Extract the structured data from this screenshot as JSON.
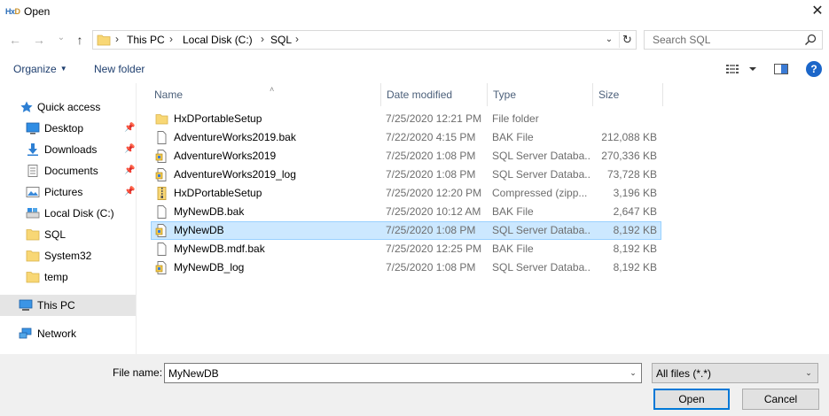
{
  "window": {
    "title": "Open",
    "app_icon_text_a": "Hx",
    "app_icon_text_b": "D",
    "close_glyph": "✕"
  },
  "nav": {
    "back_glyph": "←",
    "forward_glyph": "→",
    "recent_glyph": "⌄",
    "up_glyph": "↑"
  },
  "address": {
    "crumbs": [
      "This PC",
      "Local Disk (C:)",
      "SQL"
    ],
    "separator": "›",
    "dropdown_glyph": "⌄",
    "refresh_glyph": "↻"
  },
  "search": {
    "placeholder": "Search SQL"
  },
  "toolbar": {
    "organize_label": "Organize",
    "caret": "▼",
    "new_folder_label": "New folder",
    "help_label": "?"
  },
  "sidebar": {
    "items": [
      {
        "label": "Quick access",
        "icon": "star-icon"
      },
      {
        "label": "Desktop",
        "icon": "desktop-icon",
        "pinned": true
      },
      {
        "label": "Downloads",
        "icon": "download-icon",
        "pinned": true
      },
      {
        "label": "Documents",
        "icon": "documents-icon",
        "pinned": true
      },
      {
        "label": "Pictures",
        "icon": "pictures-icon",
        "pinned": true
      },
      {
        "label": "Local Disk (C:)",
        "icon": "drive-icon"
      },
      {
        "label": "SQL",
        "icon": "folder-icon"
      },
      {
        "label": "System32",
        "icon": "folder-icon"
      },
      {
        "label": "temp",
        "icon": "folder-icon"
      },
      {
        "label": "This PC",
        "icon": "computer-icon",
        "selected": true
      },
      {
        "label": "Network",
        "icon": "network-icon"
      }
    ],
    "pin_glyph": "📌"
  },
  "files": {
    "columns": [
      "Name",
      "Date modified",
      "Type",
      "Size"
    ],
    "sort_glyph": "˄",
    "rows": [
      {
        "name": "HxDPortableSetup",
        "date": "7/25/2020 12:21 PM",
        "type": "File folder",
        "size": "",
        "icon": "folder-icon"
      },
      {
        "name": "AdventureWorks2019.bak",
        "date": "7/22/2020 4:15 PM",
        "type": "BAK File",
        "size": "212,088 KB",
        "icon": "file-icon"
      },
      {
        "name": "AdventureWorks2019",
        "date": "7/25/2020 1:08 PM",
        "type": "SQL Server Databa...",
        "size": "270,336 KB",
        "icon": "database-file-icon"
      },
      {
        "name": "AdventureWorks2019_log",
        "date": "7/25/2020 1:08 PM",
        "type": "SQL Server Databa...",
        "size": "73,728 KB",
        "icon": "database-file-icon"
      },
      {
        "name": "HxDPortableSetup",
        "date": "7/25/2020 12:20 PM",
        "type": "Compressed (zipp...",
        "size": "3,196 KB",
        "icon": "zip-file-icon"
      },
      {
        "name": "MyNewDB.bak",
        "date": "7/25/2020 10:12 AM",
        "type": "BAK File",
        "size": "2,647 KB",
        "icon": "file-icon"
      },
      {
        "name": "MyNewDB",
        "date": "7/25/2020 1:08 PM",
        "type": "SQL Server Databa...",
        "size": "8,192 KB",
        "icon": "database-file-icon",
        "selected": true
      },
      {
        "name": "MyNewDB.mdf.bak",
        "date": "7/25/2020 12:25 PM",
        "type": "BAK File",
        "size": "8,192 KB",
        "icon": "file-icon"
      },
      {
        "name": "MyNewDB_log",
        "date": "7/25/2020 1:08 PM",
        "type": "SQL Server Databa...",
        "size": "8,192 KB",
        "icon": "database-file-icon"
      }
    ]
  },
  "bottom": {
    "file_name_label": "File name:",
    "file_name_value": "MyNewDB",
    "file_type_value": "All files (*.*)",
    "dropdown_glyph": "⌄",
    "open_label": "Open",
    "cancel_label": "Cancel"
  },
  "colors": {
    "accent": "#0078d7",
    "selection": "#cce8ff",
    "selection_border": "#99d1ff",
    "link": "#1e3e6e"
  }
}
